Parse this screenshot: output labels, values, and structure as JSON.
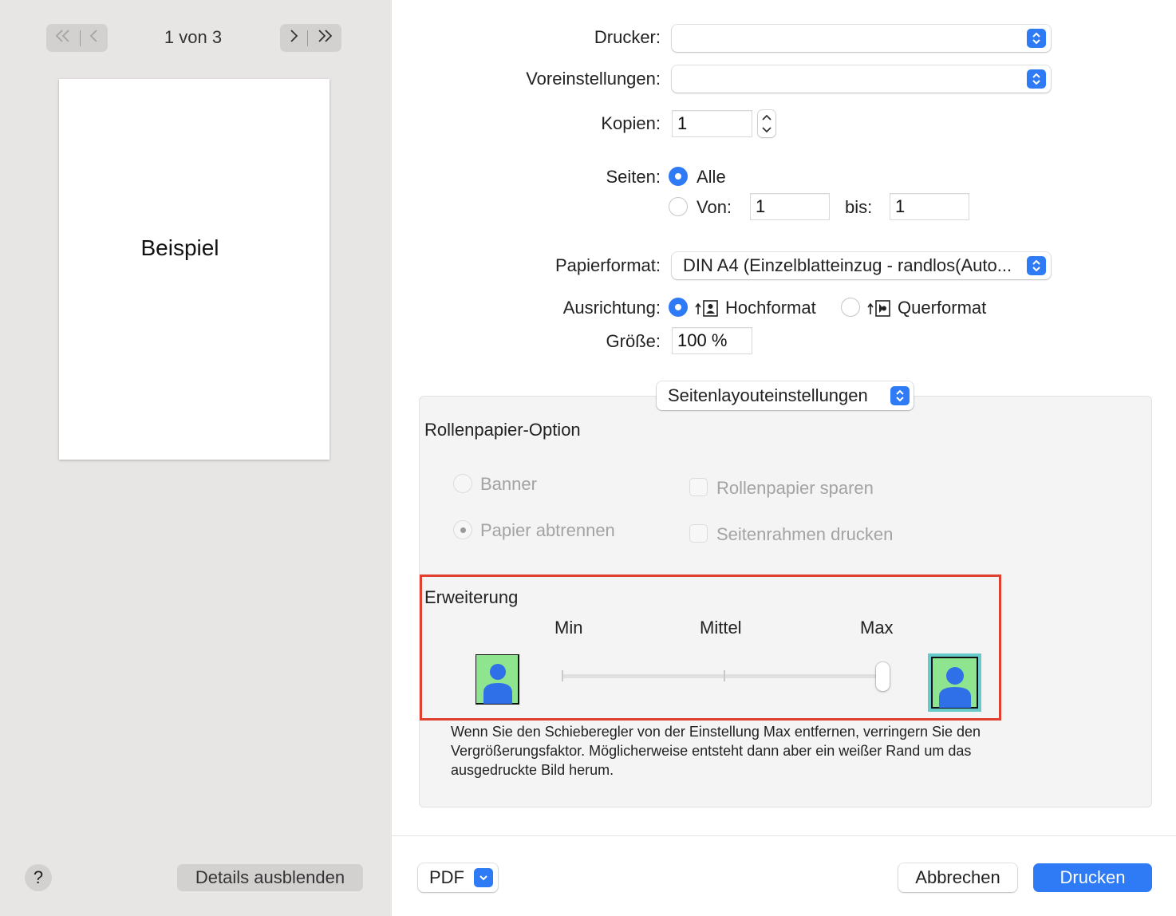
{
  "preview": {
    "page_indicator": "1 von 3",
    "sample_text": "Beispiel",
    "help_label": "?",
    "hide_details_label": "Details ausblenden"
  },
  "printer": {
    "label": "Drucker:",
    "value": ""
  },
  "presets": {
    "label": "Voreinstellungen:",
    "value": ""
  },
  "copies": {
    "label": "Kopien:",
    "value": "1"
  },
  "pages": {
    "label": "Seiten:",
    "all_label": "Alle",
    "from_label": "Von:",
    "from_value": "1",
    "to_label": "bis:",
    "to_value": "1",
    "selected": "all"
  },
  "paper_size": {
    "label": "Papierformat:",
    "value": "DIN A4 (Einzelblatteinzug - randlos(Auto..."
  },
  "orientation": {
    "label": "Ausrichtung:",
    "portrait": "Hochformat",
    "landscape": "Querformat",
    "selected": "portrait"
  },
  "scale": {
    "label": "Größe:",
    "value": "100 %"
  },
  "section_popup": "Seitenlayouteinstellungen",
  "roll_paper": {
    "title": "Rollenpapier-Option",
    "banner": "Banner",
    "cut_paper": "Papier abtrennen",
    "save_roll": "Rollenpapier sparen",
    "print_frame": "Seitenrahmen drucken",
    "selected": "cut_paper"
  },
  "expansion": {
    "title": "Erweiterung",
    "min_label": "Min",
    "mid_label": "Mittel",
    "max_label": "Max",
    "level_fraction": 1.0,
    "description": "Wenn Sie den Schieberegler von der Einstellung Max entfernen, verringern Sie den Vergrößerungsfaktor. Möglicherweise entsteht dann aber ein weißer Rand um das ausgedruckte Bild herum."
  },
  "footer": {
    "pdf_label": "PDF",
    "cancel_label": "Abbrechen",
    "print_label": "Drucken"
  },
  "colors": {
    "accent": "#2f7bf5",
    "highlight_box": "#e0402f",
    "sidebar_bg": "#e8e5e5"
  }
}
